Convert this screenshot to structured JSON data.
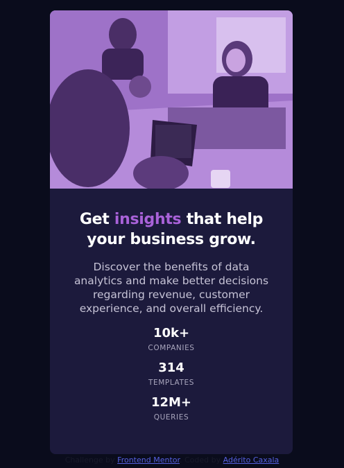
{
  "card": {
    "headline_before": "Get ",
    "headline_accent": "insights",
    "headline_after": " that help your business grow.",
    "description": "Discover the benefits of data analytics and make better decisions regarding revenue, customer experience, and overall efficiency.",
    "accent_color": "#a962d9",
    "card_color": "#1c1a3c",
    "page_color": "#0a0c1c"
  },
  "stats": [
    {
      "value": "10k+",
      "label": "COMPANIES"
    },
    {
      "value": "314",
      "label": "TEMPLATES"
    },
    {
      "value": "12M+",
      "label": "QUERIES"
    }
  ],
  "attribution": {
    "prefix": "Challenge by ",
    "link1": "Frontend Mentor",
    "middle": ". Coded by ",
    "link2": "Adérito Caxala"
  }
}
